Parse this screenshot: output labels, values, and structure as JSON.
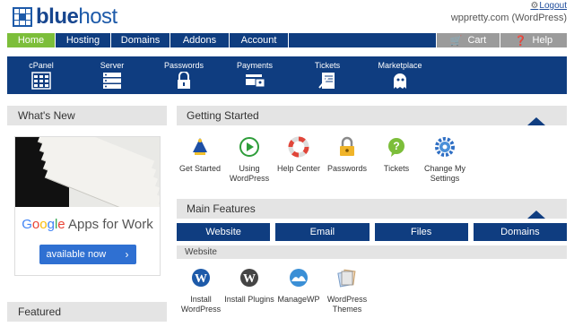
{
  "brand": {
    "name_bold": "blue",
    "name_light": "host"
  },
  "header": {
    "logout": "Logout",
    "account": "wppretty.com (WordPress)"
  },
  "topnav": {
    "home": "Home",
    "hosting": "Hosting",
    "domains": "Domains",
    "addons": "Addons",
    "account": "Account",
    "cart": "Cart",
    "help": "Help"
  },
  "iconbar": [
    {
      "label": "cPanel",
      "icon": "cpanel-icon"
    },
    {
      "label": "Server",
      "icon": "server-icon"
    },
    {
      "label": "Passwords",
      "icon": "lock-icon"
    },
    {
      "label": "Payments",
      "icon": "credit-card-icon"
    },
    {
      "label": "Tickets",
      "icon": "ticket-icon"
    },
    {
      "label": "Marketplace",
      "icon": "marketplace-icon"
    }
  ],
  "sidebar": {
    "whats_new": "What's New",
    "promo": {
      "google": [
        "G",
        "o",
        "o",
        "g",
        "l",
        "e"
      ],
      "suffix": " Apps for Work",
      "button": "available now"
    },
    "featured": "Featured"
  },
  "getting_started": {
    "title": "Getting Started",
    "items": [
      {
        "label": "Get Started",
        "icon": "wizard-icon"
      },
      {
        "label": "Using WordPress",
        "icon": "play-icon"
      },
      {
        "label": "Help Center",
        "icon": "lifebuoy-icon"
      },
      {
        "label": "Passwords",
        "icon": "padlock-icon"
      },
      {
        "label": "Tickets",
        "icon": "question-icon"
      },
      {
        "label": "Change My Settings",
        "icon": "settings-icon"
      }
    ]
  },
  "main_features": {
    "title": "Main Features",
    "tabs": [
      "Website",
      "Email",
      "Files",
      "Domains"
    ],
    "section": "Website",
    "items": [
      {
        "label": "Install WordPress",
        "icon": "wordpress-icon"
      },
      {
        "label": "Install Plugins",
        "icon": "wordpress-plugins-icon"
      },
      {
        "label": "ManageWP",
        "icon": "managewp-icon"
      },
      {
        "label": "WordPress Themes",
        "icon": "themes-icon"
      }
    ]
  },
  "colors": {
    "navy": "#0f3d80",
    "green": "#7cbe3a",
    "gray": "#9b9b9b",
    "panel": "#e4e4e4"
  }
}
